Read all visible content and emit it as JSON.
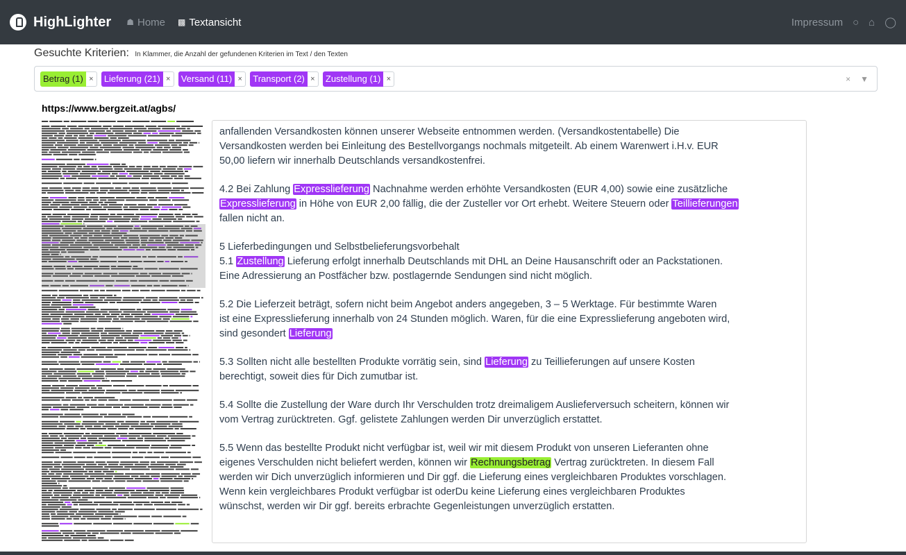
{
  "nav": {
    "brand": "HighLighter",
    "home_icon": "home-icon",
    "home": "Home",
    "textview_icon": "bar-chart-icon",
    "textview": "Textansicht",
    "impressum": "Impressum",
    "icons": [
      "github-icon",
      "bank-icon",
      "lightbulb-icon"
    ]
  },
  "criteria": {
    "title": "Gesuchte Kriterien:",
    "hint": "In Klammer, die Anzahl der gefundenen Kriterien im Text / den Texten",
    "tags": [
      {
        "label": "Betrag (1)",
        "color": "#99ee33"
      },
      {
        "label": "Lieferung (21)",
        "color": "#a036f5"
      },
      {
        "label": "Versand (11)",
        "color": "#a036f5"
      },
      {
        "label": "Transport (2)",
        "color": "#a036f5"
      },
      {
        "label": "Zustellung (1)",
        "color": "#a036f5"
      }
    ],
    "remove_glyph": "×",
    "clear_glyph": "×",
    "dropdown_glyph": "▼"
  },
  "url": "https://www.bergzeit.at/agbs/",
  "text": {
    "p1": {
      "l1": "anfallenden Versandkosten können unserer Webseite entnommen werden. (Versandkostentabelle) Die",
      "l2": "Versandkosten werden bei Einleitung des Bestellvorgangs nochmals mitgeteilt. Ab einem Warenwert i.H.v. EUR",
      "l3": "50,00 liefern wir innerhalb Deutschlands versandkostenfrei."
    },
    "p2": {
      "a": "4.2 Bei Zahlung ",
      "h1": "Expresslieferung",
      "b": " Nachnahme werden erhöhte Versandkosten (EUR 4,00) sowie eine zusätzliche",
      "h2": "Expresslieferung",
      "c": " in Höhe von EUR 2,00 fällig, die der Zusteller vor Ort erhebt. Weitere Steuern oder ",
      "h3": "Teillieferungen",
      "d": "fallen nicht an."
    },
    "p3": {
      "l1": "5 Lieferbedingungen und Selbstbelieferungsvorbehalt",
      "a": "5.1 ",
      "h1": "Zustellung",
      "b": " Lieferung erfolgt innerhalb Deutschlands mit DHL an Deine Hausanschrift oder an Packstationen.",
      "l3": "Eine Adressierung an Postfächer bzw. postlagernde Sendungen sind nicht möglich."
    },
    "p4": {
      "l1": "5.2 Die Lieferzeit beträgt, sofern nicht beim Angebot anders angegeben, 3 – 5 Werktage. Für bestimmte Waren",
      "l2": "ist eine Expresslieferung innerhalb von 24 Stunden möglich. Waren, für die eine Expresslieferung angeboten wird,",
      "a": "sind gesondert ",
      "h1": "Lieferung"
    },
    "p5": {
      "a": "5.3 Sollten nicht alle bestellten Produkte vorrätig sein, sind ",
      "h1": "Lieferung",
      "b": " zu Teillieferungen auf unsere Kosten",
      "l2": "berechtigt, soweit dies für Dich zumutbar ist."
    },
    "p6": {
      "l1": "5.4 Sollte die Zustellung der Ware durch Ihr Verschulden trotz dreimaligem Auslieferversuch scheitern, können wir",
      "l2": "vom Vertrag zurücktreten. Ggf. gelistete Zahlungen werden Dir unverzüglich erstattet."
    },
    "p7": {
      "l1": "5.5 Wenn das bestellte Produkt nicht verfügbar ist, weil wir mit diesem Produkt von unseren Lieferanten ohne",
      "a": "eigenes Verschulden nicht beliefert werden, können wir ",
      "h1": "Rechnungsbetrag",
      "b": " Vertrag zurücktreten. In diesem Fall",
      "l3": "werden wir Dich unverzüglich informieren und Dir ggf. die Lieferung eines vergleichbaren Produktes vorschlagen.",
      "l4": "Wenn kein vergleichbares Produkt verfügbar ist oderDu keine Lieferung eines vergleichbaren Produktes",
      "l5": "wünschst, werden wir Dir ggf. bereits erbrachte Gegenleistungen unverzüglich erstatten."
    }
  },
  "minimap": {
    "text_color": "#3c3c3c",
    "highlight_colors": [
      "#a036f5",
      "#99ee33"
    ]
  }
}
